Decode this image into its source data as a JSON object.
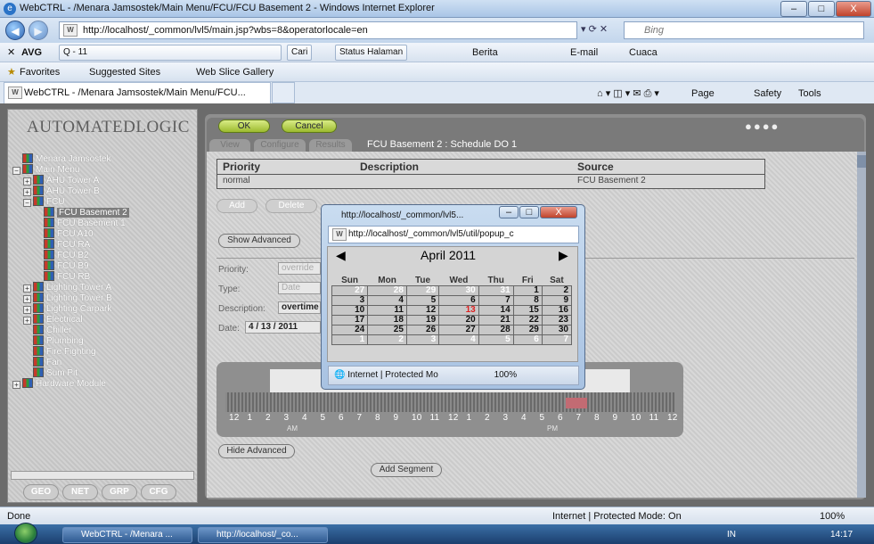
{
  "window": {
    "title": "WebCTRL - /Menara Jamsostek/Main Menu/FCU/FCU Basement 2 - Windows Internet Explorer",
    "min": "–",
    "max": "□",
    "close": "X"
  },
  "nav": {
    "url": "http://localhost/_common/lvl5/main.jsp?wbs=8&operatorlocale=en",
    "url_bold": "localhost",
    "search": "Bing",
    "back": "◀",
    "fwd": "▶"
  },
  "avg": {
    "brand": "AVG",
    "search_value": "Q - 11",
    "cari": "Cari",
    "status": "Status Halaman",
    "berita": "Berita",
    "email": "E-mail",
    "cuaca": "Cuaca"
  },
  "fav": {
    "favorites": "Favorites",
    "suggested": "Suggested Sites",
    "webslice": "Web Slice Gallery"
  },
  "tab": {
    "title": "WebCTRL - /Menara Jamsostek/Main Menu/FCU...",
    "page": "Page",
    "safety": "Safety",
    "tools": "Tools"
  },
  "logo": "AUTOMATEDLOGIC",
  "tree": [
    {
      "label": "Menara Jamsostek",
      "indent": 0,
      "pm": ""
    },
    {
      "label": "Main Menu",
      "indent": 0,
      "pm": "−"
    },
    {
      "label": "AHU Tower A",
      "indent": 1,
      "pm": "+"
    },
    {
      "label": "AHU Tower B",
      "indent": 1,
      "pm": "+"
    },
    {
      "label": "FCU",
      "indent": 1,
      "pm": "−"
    },
    {
      "label": "FCU Basement 2",
      "indent": 2,
      "pm": "",
      "sel": true
    },
    {
      "label": "FCU Basement 1",
      "indent": 2,
      "pm": ""
    },
    {
      "label": "FCU A10",
      "indent": 2,
      "pm": ""
    },
    {
      "label": "FCU RA",
      "indent": 2,
      "pm": ""
    },
    {
      "label": "FCU B2",
      "indent": 2,
      "pm": ""
    },
    {
      "label": "FCU B9",
      "indent": 2,
      "pm": ""
    },
    {
      "label": "FCU RB",
      "indent": 2,
      "pm": ""
    },
    {
      "label": "Lighting Tower A",
      "indent": 1,
      "pm": "+"
    },
    {
      "label": "Lighting Tower B",
      "indent": 1,
      "pm": "+"
    },
    {
      "label": "Lighting Carpark",
      "indent": 1,
      "pm": "+"
    },
    {
      "label": "Electrical",
      "indent": 1,
      "pm": "+"
    },
    {
      "label": "Chiller",
      "indent": 1,
      "pm": ""
    },
    {
      "label": "Plumbing",
      "indent": 1,
      "pm": ""
    },
    {
      "label": "Fire Fighting",
      "indent": 1,
      "pm": ""
    },
    {
      "label": "Fan",
      "indent": 1,
      "pm": ""
    },
    {
      "label": "Sum Pit",
      "indent": 1,
      "pm": ""
    },
    {
      "label": "Hardware Module",
      "indent": 0,
      "pm": "+"
    }
  ],
  "left_buttons": [
    "GEO",
    "NET",
    "GRP",
    "CFG"
  ],
  "main": {
    "ok": "OK",
    "cancel": "Cancel",
    "subtabs": [
      "View",
      "Configure",
      "Results"
    ],
    "breadcrumb": "FCU Basement 2 : Schedule DO 1"
  },
  "table": {
    "headers": [
      "Priority",
      "Description",
      "Source"
    ],
    "row": [
      "normal",
      "",
      "FCU Basement 2"
    ]
  },
  "buttons": {
    "add": "Add",
    "delete": "Delete",
    "show_advanced": "Show Advanced",
    "hide_advanced": "Hide Advanced",
    "add_segment": "Add Segment"
  },
  "form": {
    "priority_label": "Priority:",
    "priority_value": "override",
    "type_label": "Type:",
    "type_value": "Date",
    "desc_label": "Description:",
    "desc_value": "overtime",
    "date_label": "Date:",
    "date_value": "4 / 13 / 2011"
  },
  "timeline": {
    "hours": [
      "12",
      "1",
      "2",
      "3",
      "4",
      "5",
      "6",
      "7",
      "8",
      "9",
      "10",
      "11",
      "12",
      "1",
      "2",
      "3",
      "4",
      "5",
      "6",
      "7",
      "8",
      "9",
      "10",
      "11",
      "12"
    ],
    "am": "AM",
    "pm": "PM",
    "segment_color": "#c26b73"
  },
  "popup": {
    "title": "http://localhost/_common/lvl5...",
    "url": "http://localhost/_common/lvl5/util/popup_c",
    "url_bold": "localhost",
    "status": "Internet | Protected Mo",
    "zoom": "100%"
  },
  "calendar": {
    "month": "April 2011",
    "prev": "◀",
    "next": "▶",
    "days": [
      "Sun",
      "Mon",
      "Tue",
      "Wed",
      "Thu",
      "Fri",
      "Sat"
    ],
    "weeks": [
      [
        "27",
        "28",
        "29",
        "30",
        "31",
        "1",
        "2"
      ],
      [
        "3",
        "4",
        "5",
        "6",
        "7",
        "8",
        "9"
      ],
      [
        "10",
        "11",
        "12",
        "13",
        "14",
        "15",
        "16"
      ],
      [
        "17",
        "18",
        "19",
        "20",
        "21",
        "22",
        "23"
      ],
      [
        "24",
        "25",
        "26",
        "27",
        "28",
        "29",
        "30"
      ],
      [
        "1",
        "2",
        "3",
        "4",
        "5",
        "6",
        "7"
      ]
    ],
    "other_month": [
      [
        0,
        1,
        2,
        3,
        4
      ],
      [],
      [],
      [],
      [],
      [
        0,
        1,
        2,
        3,
        4,
        5,
        6
      ]
    ],
    "today": [
      2,
      3
    ],
    "today_color": "#d22"
  },
  "status": {
    "left": "Done",
    "zone": "Internet | Protected Mode: On",
    "zoom": "100%"
  },
  "taskbar": {
    "items": [
      "WebCTRL - /Menara ...",
      "http://localhost/_co..."
    ],
    "lang": "IN",
    "clock": "14:17"
  }
}
